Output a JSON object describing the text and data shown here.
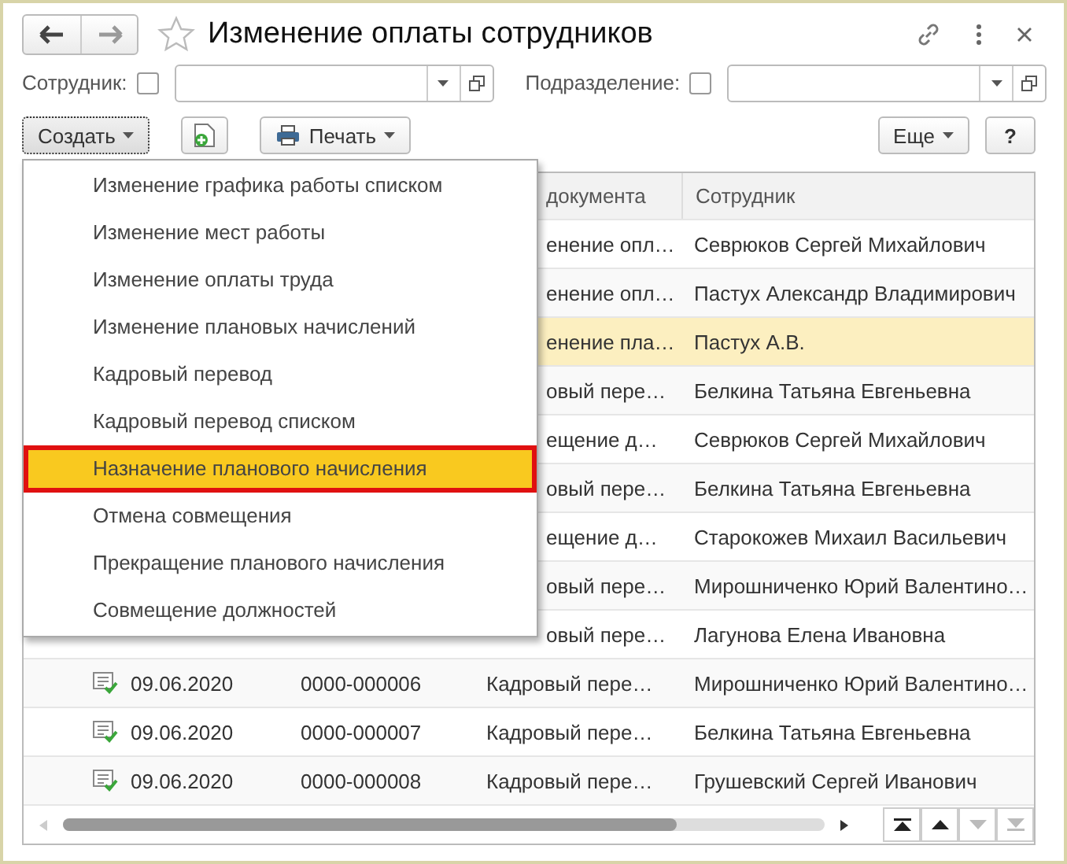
{
  "window": {
    "title": "Изменение оплаты сотрудников",
    "favorite": false
  },
  "filters": [
    {
      "label": "Сотрудник:",
      "checked": false
    },
    {
      "label": "Подразделение:",
      "checked": false
    }
  ],
  "toolbar": {
    "create": "Создать",
    "print": "Печать",
    "more": "Еще",
    "help": "?"
  },
  "menu": [
    {
      "label": "Изменение графика работы списком",
      "selected": false
    },
    {
      "label": "Изменение мест работы",
      "selected": false
    },
    {
      "label": "Изменение оплаты труда",
      "selected": false
    },
    {
      "label": "Изменение плановых начислений",
      "selected": false
    },
    {
      "label": "Кадровый перевод",
      "selected": false
    },
    {
      "label": "Кадровый перевод списком",
      "selected": false
    },
    {
      "label": "Назначение планового начисления",
      "selected": true
    },
    {
      "label": "Отмена совмещения",
      "selected": false
    },
    {
      "label": "Прекращение планового начисления",
      "selected": false
    },
    {
      "label": "Совмещение должностей",
      "selected": false
    }
  ],
  "table": {
    "columns": [
      "документа",
      "Сотрудник"
    ],
    "rows": [
      {
        "kind": "covered",
        "type": "енение опл…",
        "employee": "Севрюков Сергей Михайлович",
        "selected": false
      },
      {
        "kind": "covered",
        "type": "енение опл…",
        "employee": "Пастух Александр Владимирович",
        "selected": false
      },
      {
        "kind": "covered",
        "type": "енение пла…",
        "employee": "Пастух А.В.",
        "selected": true
      },
      {
        "kind": "covered",
        "type": "овый пере…",
        "employee": "Белкина Татьяна Евгеньевна",
        "selected": false
      },
      {
        "kind": "covered",
        "type": "ещение д…",
        "employee": "Севрюков Сергей Михайлович",
        "selected": false
      },
      {
        "kind": "covered",
        "type": "овый пере…",
        "employee": "Белкина Татьяна Евгеньевна",
        "selected": false
      },
      {
        "kind": "covered",
        "type": "ещение д…",
        "employee": "Старокожев Михаил Васильевич",
        "selected": false
      },
      {
        "kind": "covered",
        "type": "овый пере…",
        "employee": "Мирошниченко Юрий Валентино…",
        "selected": false
      },
      {
        "kind": "covered",
        "type": "овый пере…",
        "employee": "Лагунова Елена Ивановна",
        "selected": false
      },
      {
        "kind": "full",
        "date": "09.06.2020",
        "number": "0000-000006",
        "type": "Кадровый пере…",
        "employee": "Мирошниченко Юрий Валентино…",
        "selected": false
      },
      {
        "kind": "full",
        "date": "09.06.2020",
        "number": "0000-000007",
        "type": "Кадровый пере…",
        "employee": "Белкина Татьяна Евгеньевна",
        "selected": false
      },
      {
        "kind": "full",
        "date": "09.06.2020",
        "number": "0000-000008",
        "type": "Кадровый пере…",
        "employee": "Грушевский Сергей Иванович",
        "selected": false
      }
    ]
  }
}
